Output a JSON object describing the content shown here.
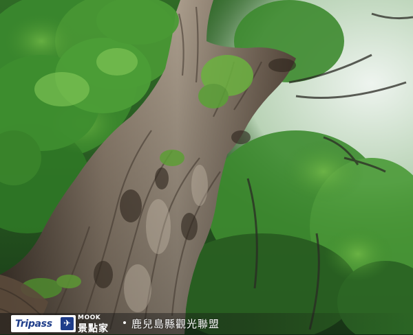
{
  "watermark": {
    "logo_text": "Tripass",
    "logo_icon": "airplane-icon",
    "mook_label": "MOOK",
    "jingdian_label": "景點家",
    "credit": "鹿兒島縣觀光聯盟"
  },
  "colors": {
    "foliage_dark": "#1f4a1c",
    "foliage_bright": "#5aa23a",
    "trunk": "#8a7a68",
    "sky": "#e6efe8",
    "logo_blue": "#1f3d8a"
  }
}
